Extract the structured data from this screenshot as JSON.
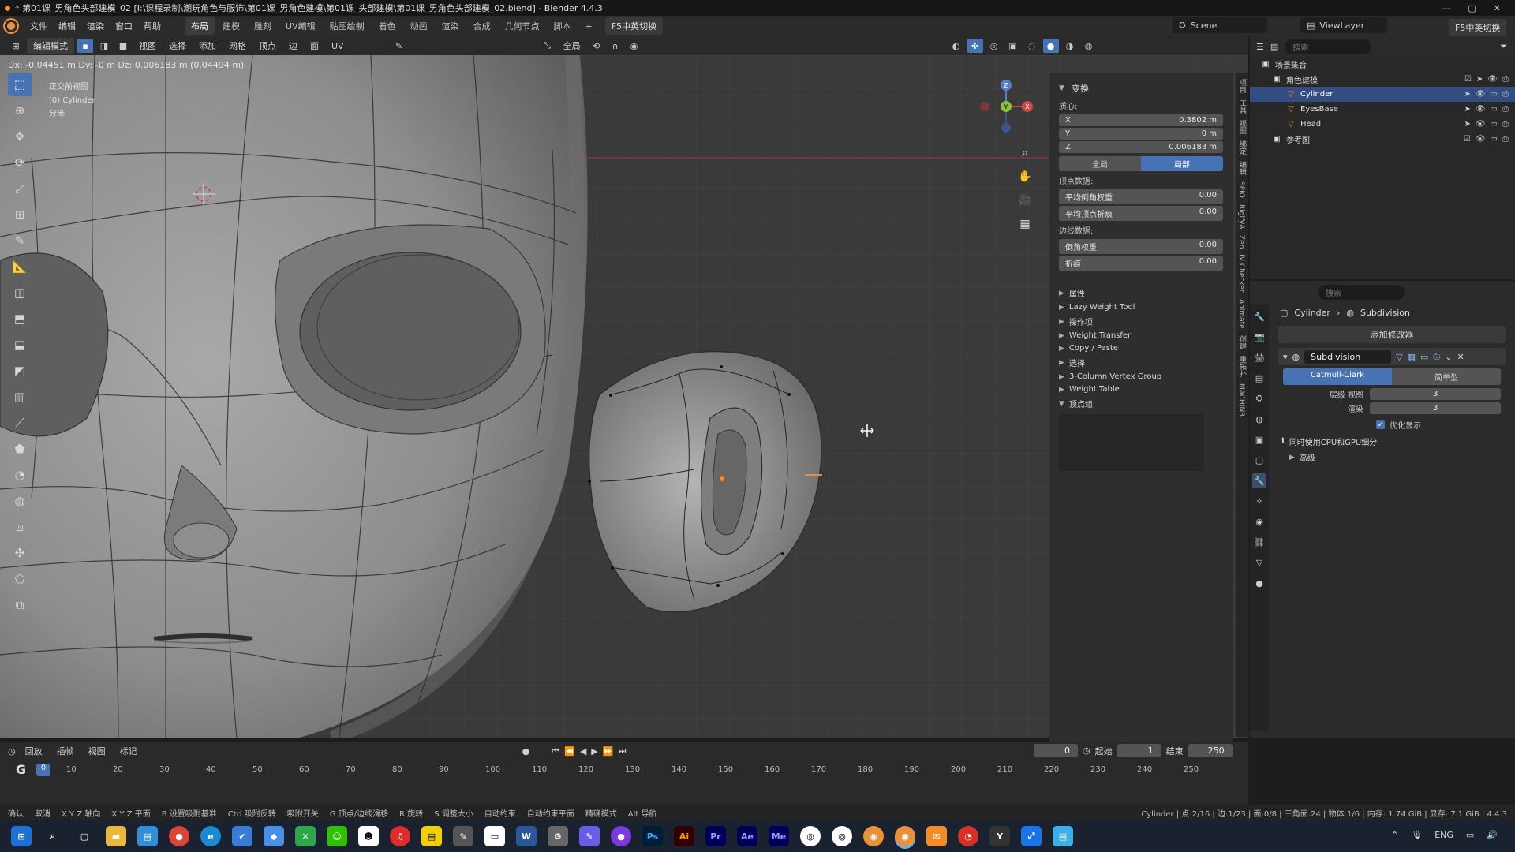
{
  "window": {
    "title": "* 第01课_男角色头部建模_02 [I:\\课程录制\\潮玩角色与服饰\\第01课_男角色建模\\第01课_头部建模\\第01课_男角色头部建模_02.blend] - Blender 4.4.3",
    "controls": [
      "—",
      "▢",
      "✕"
    ]
  },
  "menubar": {
    "items": [
      "文件",
      "编辑",
      "渲染",
      "窗口",
      "帮助"
    ],
    "workspaces": [
      "布局",
      "建模",
      "雕刻",
      "UV编辑",
      "贴图绘制",
      "着色",
      "动画",
      "渲染",
      "合成",
      "几何节点",
      "脚本"
    ],
    "active_workspace": "布局",
    "add_tab": "+",
    "ime_button": "F5中英切换",
    "scene": "Scene",
    "view_layer": "ViewLayer",
    "ime_button_right": "F5中英切换"
  },
  "header3d": {
    "mode": "编辑模式",
    "menus": [
      "视图",
      "选择",
      "添加",
      "网格",
      "顶点",
      "边",
      "面",
      "UV"
    ],
    "orientation": "全局"
  },
  "viewport": {
    "status_delta": "Dx: -0.04451 m  Dy: -0 m  Dz: 0.006183 m (0.04494 m)",
    "view_name": "正交前视图",
    "object_name": "(0) Cylinder",
    "units": "分米",
    "gizmo": {
      "z": "Z",
      "y": "Y",
      "x": "X"
    }
  },
  "npanel": {
    "transform": {
      "title": "变换",
      "median_label": "质心:",
      "x_label": "X",
      "x": "0.3802 m",
      "y_label": "Y",
      "y": "0 m",
      "z_label": "Z",
      "z": "0.006183 m",
      "global": "全局",
      "local": "局部"
    },
    "vertex_data": {
      "title": "顶点数据:",
      "mean_bevel_label": "平均倒角权重",
      "mean_bevel": "0.00",
      "mean_crease_label": "平均顶点折痕",
      "mean_crease": "0.00"
    },
    "edge_data": {
      "title": "边线数据:",
      "bevel_label": "倒角权重",
      "bevel": "0.00",
      "crease_label": "折痕",
      "crease": "0.00"
    },
    "panels": [
      "属性",
      "Lazy Weight Tool",
      "操作项",
      "Weight Transfer",
      "Copy / Paste",
      "选择",
      "3-Column Vertex Group",
      "Weight Table"
    ],
    "vertex_groups": "顶点组",
    "side_tabs": [
      "项目",
      "工具",
      "视图",
      "绑定",
      "编辑",
      "SPIO",
      "RigifyA",
      "Zen UV Checker",
      "Animate",
      "创建",
      "重拓扑",
      "MACHIN3"
    ]
  },
  "outliner": {
    "search_placeholder": "搜索",
    "rows": [
      {
        "label": "场景集合",
        "depth": 0
      },
      {
        "label": "角色建模",
        "depth": 1
      },
      {
        "label": "Cylinder",
        "depth": 2
      },
      {
        "label": "EyesBase",
        "depth": 2
      },
      {
        "label": "Head",
        "depth": 2
      },
      {
        "label": "参考图",
        "depth": 1
      }
    ]
  },
  "properties": {
    "search_placeholder": "搜索",
    "breadcrumb_object": "Cylinder",
    "breadcrumb_modifier": "Subdivision",
    "add_modifier": "添加修改器",
    "modifier_name": "Subdivision",
    "catmull": "Catmull-Clark",
    "simple": "简单型",
    "levels_viewport_label": "层级 视图",
    "levels_viewport": "3",
    "render_label": "渲染",
    "render": "3",
    "optimal_display": "优化显示",
    "gpu_note": "同时使用CPU和GPU细分",
    "advanced": "高级"
  },
  "timeline": {
    "menus": [
      "回放",
      "插帧",
      "视图",
      "标记"
    ],
    "current_frame": "0",
    "start_label": "起始",
    "start": "1",
    "end_label": "结束",
    "end": "250",
    "ruler_frame": "0",
    "ticks": [
      "10",
      "20",
      "30",
      "40",
      "50",
      "60",
      "70",
      "80",
      "90",
      "100",
      "110",
      "120",
      "130",
      "140",
      "150",
      "160",
      "170",
      "180",
      "190",
      "200",
      "210",
      "220",
      "230",
      "240",
      "250"
    ]
  },
  "statusbar": {
    "hints": [
      "确认",
      "取消",
      "X Y Z 轴向",
      "X Y Z 平面",
      "B 设置吸附基准",
      "Ctrl 吸附反转",
      "吸附开关",
      "G 顶点/边线滑移",
      "R 旋转",
      "S 调整大小",
      "自动约束",
      "自动约束平面",
      "精确模式",
      "Alt 导航"
    ],
    "right_info": "Cylinder | 点:2/16 | 边:1/23 | 面:0/8 | 三角面:24 | 物体:1/6 | 内存: 1.74 GiB | 显存: 7.1 GiB | 4.4.3"
  },
  "taskbar": {
    "apps": [
      "Ps",
      "Ai",
      "Pr",
      "Ae",
      "Me",
      "Y"
    ],
    "lang": "ENG"
  }
}
